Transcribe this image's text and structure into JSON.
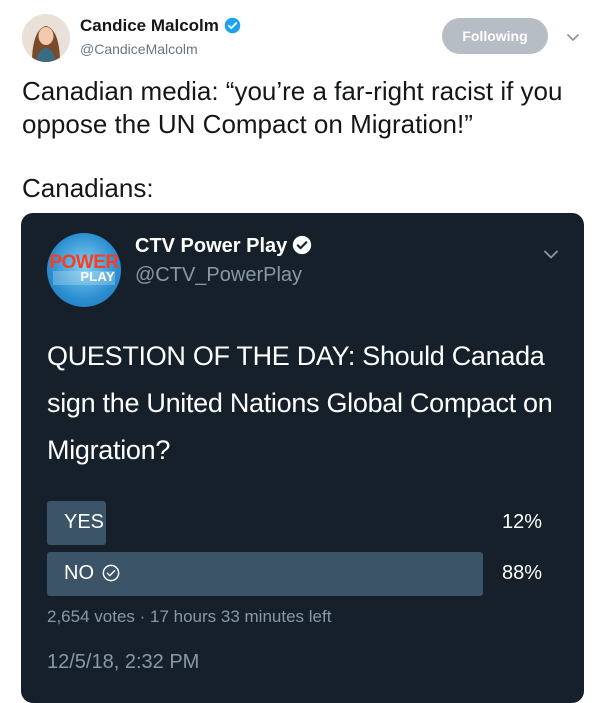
{
  "tweet": {
    "author_name": "Candice Malcolm",
    "author_handle": "@CandiceMalcolm",
    "follow_button_label": "Following",
    "text_line1": "Canadian media: “you’re a far-right racist if you oppose the UN Compact on Migration!”",
    "text_line2": "Canadians:"
  },
  "embedded_tweet": {
    "logo_power": "POWER",
    "logo_play": "PLAY",
    "author_name": "CTV Power Play",
    "author_handle": "@CTV_PowerPlay",
    "question": "QUESTION OF THE DAY: Should Canada sign the United Nations Global Compact on Migration?",
    "poll": {
      "options": [
        {
          "label": "YES",
          "percent_label": "12%",
          "fraction": 0.12,
          "selected": false
        },
        {
          "label": "NO",
          "percent_label": "88%",
          "fraction": 0.88,
          "selected": true
        }
      ],
      "votes_line": "2,654 votes · 17 hours 33 minutes left"
    },
    "timestamp": "12/5/18, 2:32 PM"
  },
  "colors": {
    "verified_blue": "#1da1f2",
    "embed_background": "#15202b",
    "poll_bar": "#3b5468",
    "follow_button": "#b6bdc4"
  },
  "icons": [
    "verified-badge-icon",
    "chevron-down-icon",
    "check-circle-icon"
  ]
}
